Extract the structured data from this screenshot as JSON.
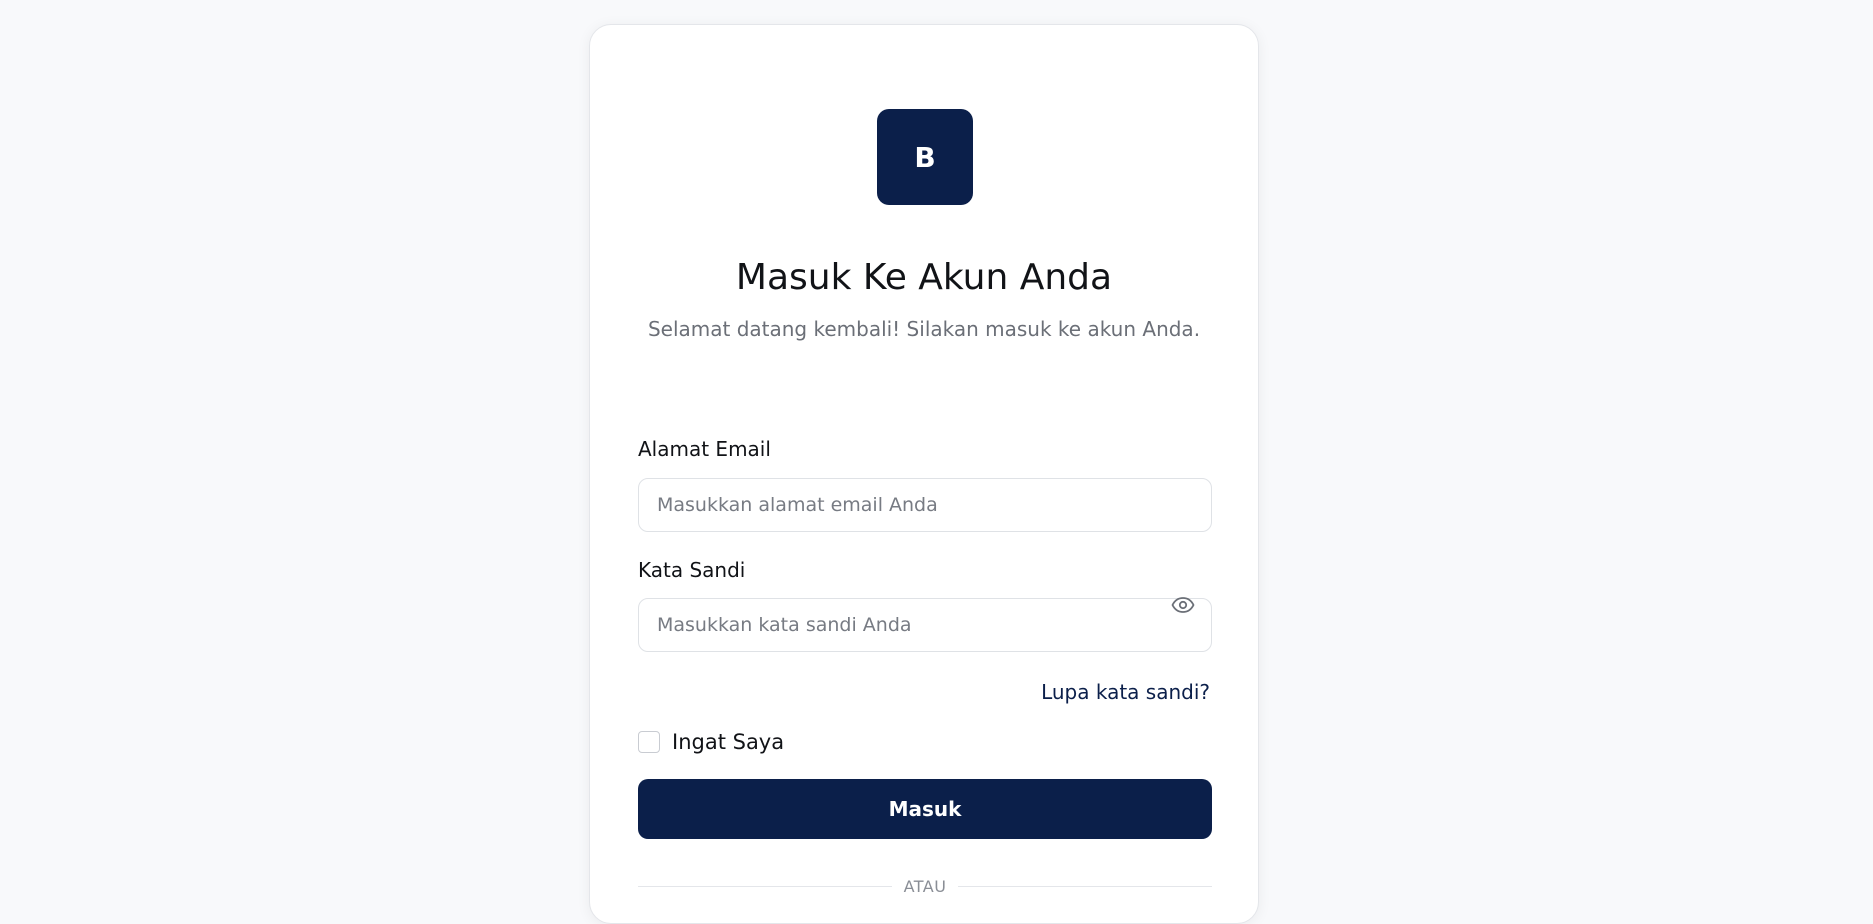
{
  "brand": {
    "logo_letter": "B",
    "color": "#0b1f4a"
  },
  "header": {
    "title": "Masuk Ke Akun Anda",
    "subtitle": "Selamat datang kembali! Silakan masuk ke akun Anda."
  },
  "form": {
    "email": {
      "label": "Alamat Email",
      "placeholder": "Masukkan alamat email Anda",
      "value": ""
    },
    "password": {
      "label": "Kata Sandi",
      "placeholder": "Masukkan kata sandi Anda",
      "value": "",
      "toggle_icon": "eye-icon"
    },
    "forgot_link": "Lupa kata sandi?",
    "remember_label": "Ingat Saya",
    "remember_checked": false,
    "submit_label": "Masuk",
    "divider_text": "ATAU"
  }
}
